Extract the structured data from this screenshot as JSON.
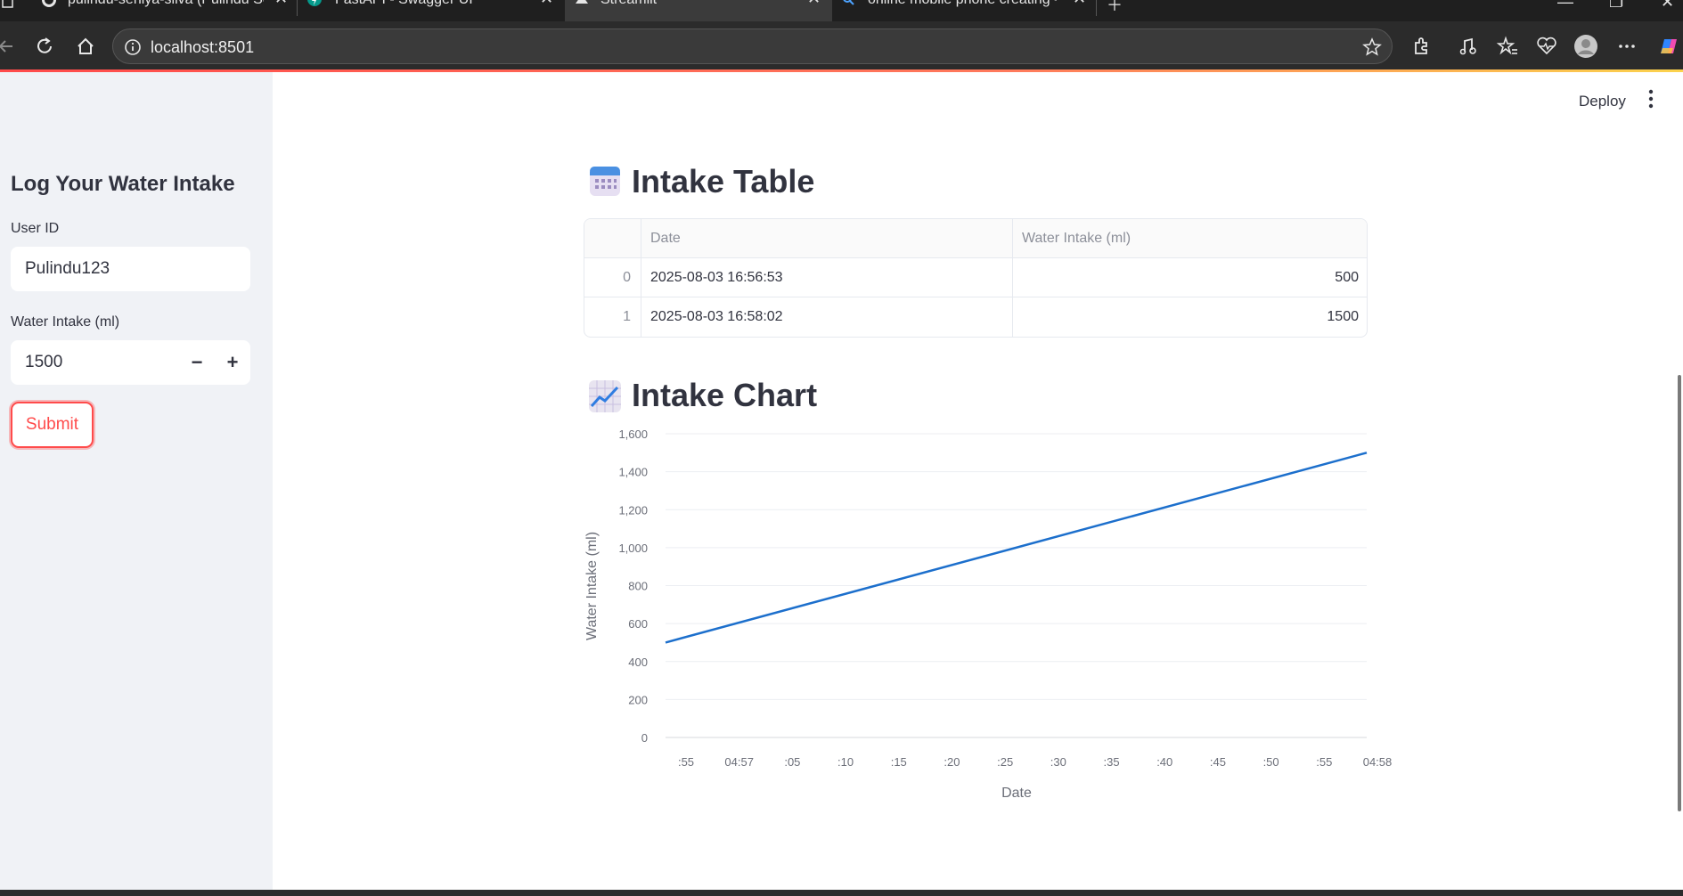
{
  "browser": {
    "tabs": [
      {
        "label": "pulindu-seniya-silva (Pulindu Seni",
        "icon": "github-icon"
      },
      {
        "label": "FastAPI - Swagger UI",
        "icon": "fastapi-icon"
      },
      {
        "label": "Streamlit",
        "icon": "streamlit-icon",
        "active": true
      },
      {
        "label": "online mobile phone creating - Se",
        "icon": "search-icon"
      }
    ],
    "url": "localhost:8501"
  },
  "sidebar": {
    "title": "Log Your Water Intake",
    "user_id_label": "User ID",
    "user_id_value": "Pulindu123",
    "intake_label": "Water Intake (ml)",
    "intake_value": "1500",
    "minus": "−",
    "plus": "+",
    "submit_label": "Submit"
  },
  "header": {
    "deploy_label": "Deploy"
  },
  "table_section": {
    "icon": "calendar-icon",
    "title": "Intake Table",
    "columns": [
      "",
      "Date",
      "Water Intake (ml)"
    ],
    "rows": [
      {
        "index": "0",
        "date": "2025-08-03 16:56:53",
        "intake": "500"
      },
      {
        "index": "1",
        "date": "2025-08-03 16:58:02",
        "intake": "1500"
      }
    ]
  },
  "chart_section": {
    "icon": "chart-increasing-icon",
    "title": "Intake Chart"
  },
  "chart_data": {
    "type": "line",
    "xlabel": "Date",
    "ylabel": "Water Intake (ml)",
    "x_tick_labels": [
      ":55",
      "04:57",
      ":05",
      ":10",
      ":15",
      ":20",
      ":25",
      ":30",
      ":35",
      ":40",
      ":45",
      ":50",
      ":55",
      "04:58"
    ],
    "y_tick_labels": [
      "0",
      "200",
      "400",
      "600",
      "800",
      "1,000",
      "1,200",
      "1,400",
      "1,600"
    ],
    "ylim": [
      0,
      1600
    ],
    "grid": true,
    "line_color": "#1c6fcc",
    "series": [
      {
        "x": [
          "2025-08-03 16:56:53",
          "2025-08-03 16:58:02"
        ],
        "values": [
          500,
          1500
        ]
      }
    ]
  }
}
